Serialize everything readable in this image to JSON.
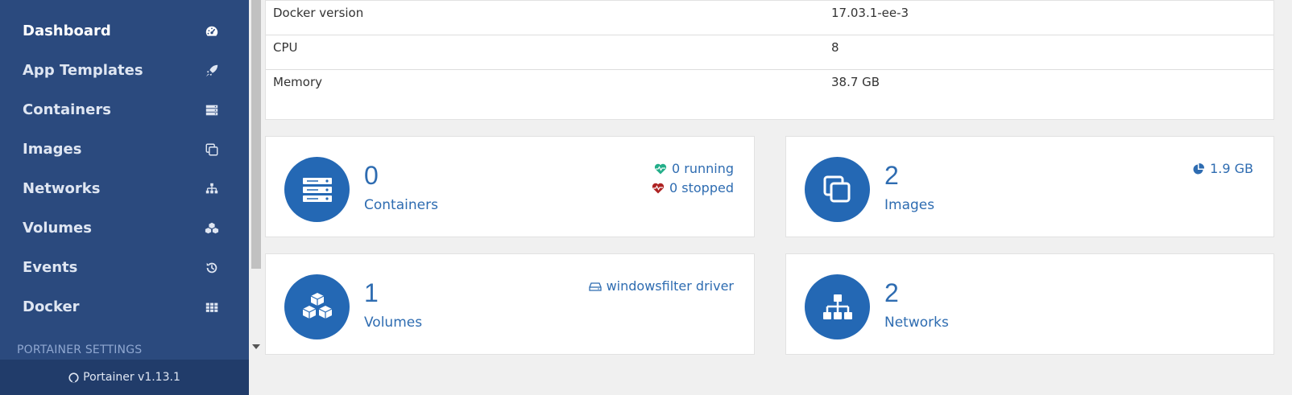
{
  "sidebar": {
    "items": [
      {
        "label": "Dashboard",
        "icon": "tachometer-icon",
        "active": true
      },
      {
        "label": "App Templates",
        "icon": "rocket-icon"
      },
      {
        "label": "Containers",
        "icon": "server-icon"
      },
      {
        "label": "Images",
        "icon": "clone-icon"
      },
      {
        "label": "Networks",
        "icon": "sitemap-icon"
      },
      {
        "label": "Volumes",
        "icon": "cubes-icon"
      },
      {
        "label": "Events",
        "icon": "history-icon"
      },
      {
        "label": "Docker",
        "icon": "th-icon"
      }
    ],
    "settings_heading": "PORTAINER SETTINGS",
    "footer": "Portainer v1.13.1"
  },
  "info": {
    "rows": [
      {
        "key": "Docker version",
        "value": "17.03.1-ee-3"
      },
      {
        "key": "CPU",
        "value": "8"
      },
      {
        "key": "Memory",
        "value": "38.7 GB"
      }
    ]
  },
  "widgets": {
    "containers": {
      "count": "0",
      "label": "Containers",
      "running": "0 running",
      "stopped": "0 stopped"
    },
    "images": {
      "count": "2",
      "label": "Images",
      "size": "1.9 GB"
    },
    "volumes": {
      "count": "1",
      "label": "Volumes",
      "driver": "windowsfilter driver"
    },
    "networks": {
      "count": "2",
      "label": "Networks"
    }
  },
  "colors": {
    "sidebar": "#2b4a7e",
    "accent": "#2468b4",
    "running": "#23ae89",
    "stopped": "#ae2323"
  }
}
